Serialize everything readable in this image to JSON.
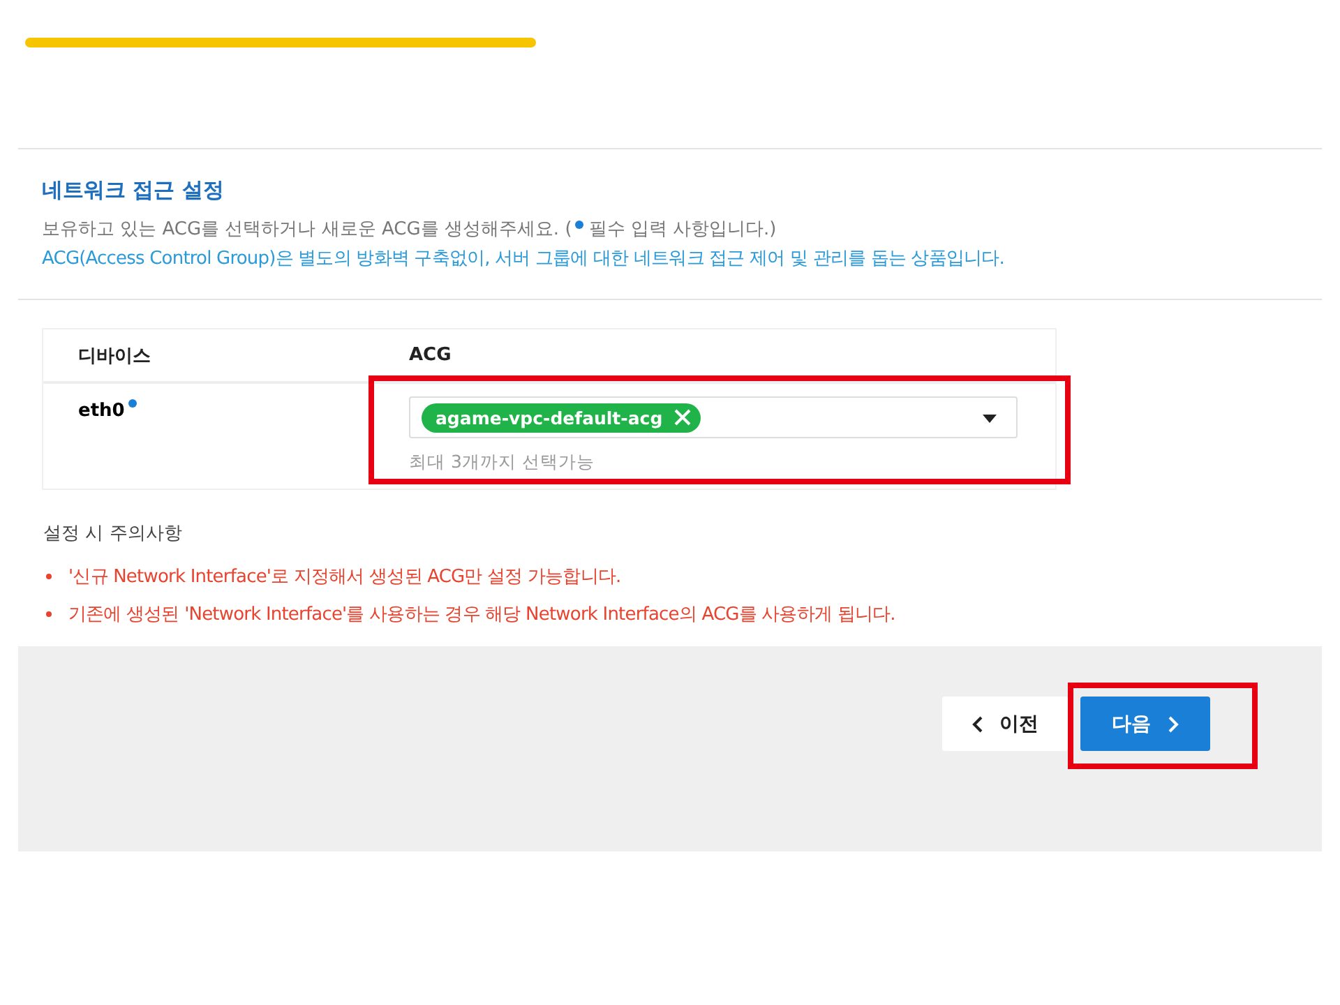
{
  "section": {
    "title": "네트워크 접근 설정",
    "hint_before": "보유하고 있는 ACG를 선택하거나 새로운 ACG를 생성해주세요. (",
    "hint_after": "필수 입력 사항입니다.)",
    "description": "ACG(Access Control Group)은 별도의 방화벽 구축없이, 서버 그룹에 대한 네트워크 접근 제어 및 관리를 돕는 상품입니다."
  },
  "table": {
    "columns": [
      "디바이스",
      "ACG"
    ],
    "rows": [
      {
        "device": "eth0",
        "required": true,
        "tags": [
          "agame-vpc-default-acg"
        ],
        "helper": "최대 3개까지 선택가능",
        "highlighted": true
      }
    ]
  },
  "notes": {
    "title": "설정 시 주의사항",
    "items": [
      "'신규 Network Interface'로 지정해서 생성된 ACG만 설정 가능합니다.",
      "기존에 생성된 'Network Interface'를 사용하는 경우 해당 Network Interface의 ACG를 사용하게 됩니다."
    ]
  },
  "buttons": [
    {
      "kind": "prev",
      "label": "이전",
      "highlighted": false
    },
    {
      "kind": "next",
      "label": "다음",
      "highlighted": true
    }
  ]
}
